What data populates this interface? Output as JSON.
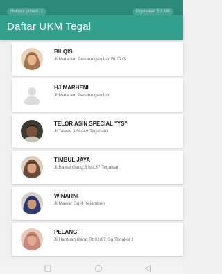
{
  "status_bar": {
    "left_pill": "Hotspot pribadi: 1",
    "right_pill": "Digunakan 5.3 MB"
  },
  "app_bar": {
    "title": "Daftar UKM Tegal"
  },
  "ukm_list": [
    {
      "name": "BILQIS",
      "address": "Jl.Mataram Pesurungan Lor Rt.07/3",
      "avatar": "woman-hijab-photo"
    },
    {
      "name": "HJ.MARHENI",
      "address": "Jl.Mataram Pesurungan Lor",
      "avatar": "person-placeholder-icon"
    },
    {
      "name": "TELOR ASIN SPECIAL \"YS\"",
      "address": "Jl.Tawes 3 No.49 Tegalsari",
      "avatar": "man-photo"
    },
    {
      "name": "TIMBUL JAYA",
      "address": "Jl.Bawal Gang.5 No.37 Tegalsari",
      "avatar": "woman-hijab-photo"
    },
    {
      "name": "WINARNI",
      "address": "Jl.Mawar Gg.4 Kejambon",
      "avatar": "woman-hijab-photo"
    },
    {
      "name": "PELANGI",
      "address": "Jl.Hantuah Barat Rt.01/07 Gg Tongkol 1",
      "avatar": "woman-hijab-photo"
    }
  ],
  "nav_bar": {
    "buttons": [
      "recent-apps-icon",
      "home-icon",
      "back-icon"
    ]
  },
  "colors": {
    "app_bar": "#33a08e",
    "status_bar": "#2c8a7a",
    "card": "#ffffff",
    "background": "#f0f0f0"
  }
}
